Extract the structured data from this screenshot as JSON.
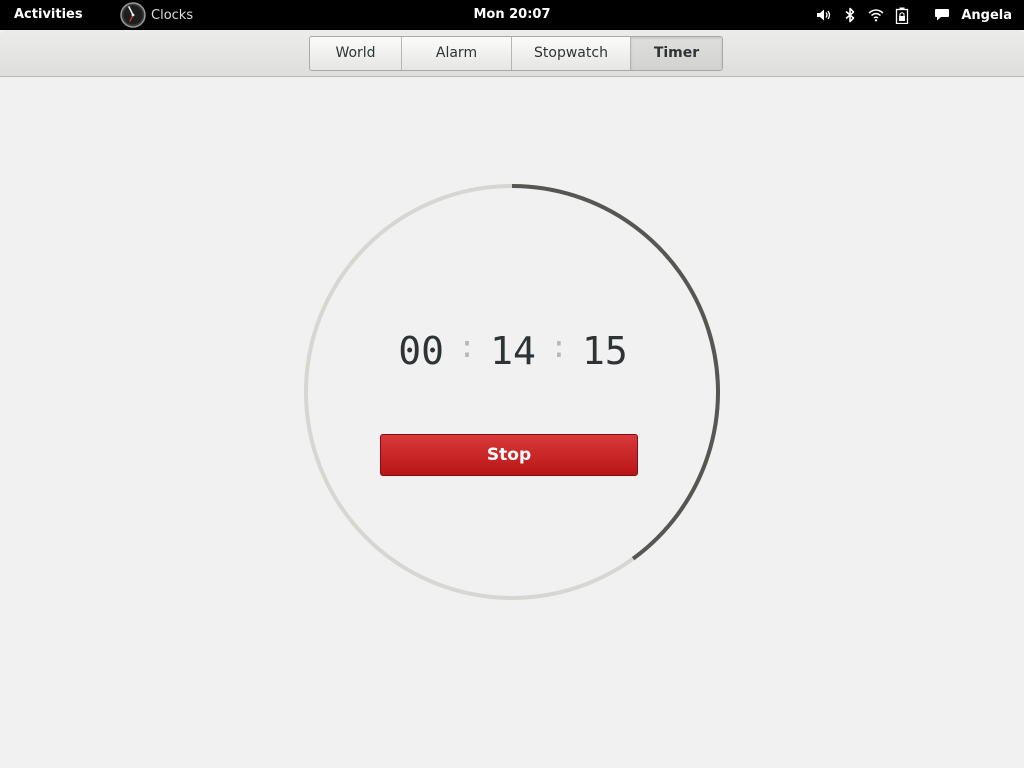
{
  "top_panel": {
    "activities": "Activities",
    "app_name": "Clocks",
    "clock": "Mon 20:07",
    "user": "Angela",
    "status_icons": [
      "volume-icon",
      "bluetooth-icon",
      "wifi-icon",
      "battery-icon"
    ],
    "chat_icon": "chat-icon"
  },
  "tabs": [
    {
      "label": "World",
      "active": false
    },
    {
      "label": "Alarm",
      "active": false
    },
    {
      "label": "Stopwatch",
      "active": false
    },
    {
      "label": "Timer",
      "active": true
    }
  ],
  "timer": {
    "hours": "00",
    "minutes": "14",
    "seconds": "15",
    "separator": ":",
    "stop_label": "Stop",
    "progress_fraction": 0.4,
    "ring_track_color": "#d6d6d2",
    "ring_progress_color": "#555753",
    "stop_color": "#c4191a"
  }
}
